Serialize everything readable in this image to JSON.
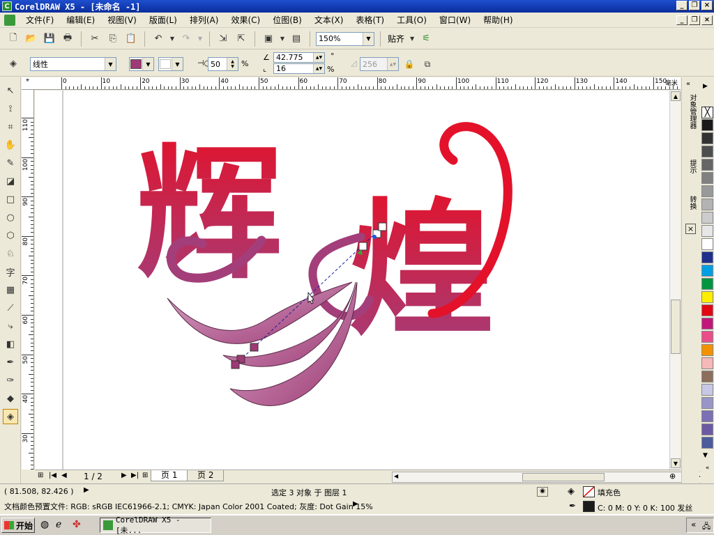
{
  "window": {
    "title": "CorelDRAW X5 - [未命名 -1]"
  },
  "menus": [
    "文件(F)",
    "编辑(E)",
    "视图(V)",
    "版面(L)",
    "排列(A)",
    "效果(C)",
    "位图(B)",
    "文本(X)",
    "表格(T)",
    "工具(O)",
    "窗口(W)",
    "帮助(H)"
  ],
  "toolbar": {
    "zoom": "150%",
    "snap_label": "贴齐"
  },
  "property_bar": {
    "fill_type": "线性",
    "primary_color": "#9e3a75",
    "secondary_color": "#ffffff",
    "midpoint": "50",
    "midpoint_unit": "%",
    "angle": "42.775",
    "angle_unit": "°",
    "edge_pad": "16",
    "edge_pad_unit": "%",
    "steps": "256"
  },
  "ruler": {
    "unit": "毫米",
    "h_ticks": [
      "0",
      "10",
      "20",
      "30",
      "40",
      "50",
      "60",
      "70",
      "80",
      "90",
      "100",
      "110",
      "120",
      "130",
      "140",
      "150"
    ],
    "v_ticks": [
      "110",
      "100",
      "90",
      "80",
      "70",
      "60",
      "50",
      "40",
      "30"
    ]
  },
  "artwork": {
    "char_left": "辉",
    "char_right": "煌",
    "top_color": "#e3122a",
    "bottom_color": "#a33e7a"
  },
  "pages": {
    "indicator": "1 / 2",
    "tabs": [
      "页 1",
      "页 2"
    ]
  },
  "status": {
    "coords": "( 81.508, 82.426 )",
    "selection": "选定 3 对象 于 图层 1",
    "fill_label": "填充色",
    "outline_label": "C: 0 M: 0 Y: 0 K: 100  发丝",
    "color_profile": "文档颜色预置文件: RGB: sRGB IEC61966-2.1; CMYK: Japan Color 2001 Coated; 灰度: Dot Gain 15%"
  },
  "dockers": [
    "对象管理器",
    "提示",
    "转换"
  ],
  "palette": [
    "#ffffff",
    "#1a1a1a",
    "#333333",
    "#4d4d4d",
    "#666666",
    "#808080",
    "#999999",
    "#b3b3b3",
    "#cccccc",
    "#e6e6e6",
    "#ffffff",
    "#1e2f8c",
    "#009fe3",
    "#009640",
    "#ffed00",
    "#e30613",
    "#c2187b",
    "#e94e8a",
    "#f39200",
    "#f6b8b8",
    "#8b6e5c",
    "#c8c8e6",
    "#9a95c8",
    "#7b6fb5",
    "#6b5aa3",
    "#4b5b9c"
  ],
  "taskbar": {
    "start": "开始",
    "task": "CorelDRAW X5 - [未..."
  }
}
